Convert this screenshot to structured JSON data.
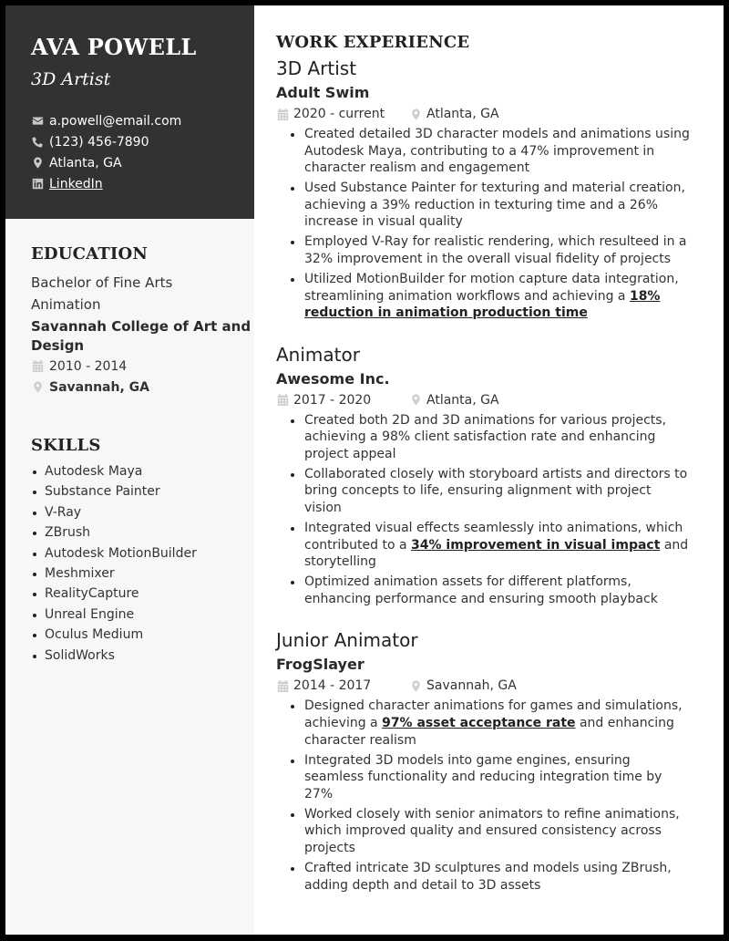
{
  "profile": {
    "name": "AVA POWELL",
    "role": "3D Artist",
    "contacts": {
      "email": "a.powell@email.com",
      "phone": "(123) 456-7890",
      "location": "Atlanta, GA",
      "linkedin": "LinkedIn"
    }
  },
  "education": {
    "title": "EDUCATION",
    "degree": "Bachelor of Fine Arts",
    "field": "Animation",
    "school": "Savannah College of Art and Design",
    "dates": "2010 - 2014",
    "location": "Savannah, GA"
  },
  "skills": {
    "title": "SKILLS",
    "items": [
      "Autodesk Maya",
      "Substance Painter",
      "V-Ray",
      "ZBrush",
      "Autodesk MotionBuilder",
      "Meshmixer",
      "RealityCapture",
      "Unreal Engine",
      "Oculus Medium",
      "SolidWorks"
    ]
  },
  "experience": {
    "title": "WORK EXPERIENCE",
    "jobs": [
      {
        "title": "3D Artist",
        "company": "Adult Swim",
        "dates": "2020 - current",
        "location": "Atlanta, GA",
        "bullets": [
          {
            "pre": "Created detailed 3D character models and animations using Autodesk Maya, contributing to a 47% improvement in character realism and engagement",
            "hl": "",
            "post": ""
          },
          {
            "pre": "Used Substance Painter for texturing and material creation, achieving a 39% reduction in texturing time and a 26% increase in visual quality",
            "hl": "",
            "post": ""
          },
          {
            "pre": "Employed V-Ray for realistic rendering, which resulteed in a 32% improvement in the overall visual fidelity of projects",
            "hl": "",
            "post": ""
          },
          {
            "pre": "Utilized MotionBuilder for motion capture data integration, streamlining animation workflows and achieving a ",
            "hl": "18% reduction in animation production time",
            "post": ""
          }
        ]
      },
      {
        "title": "Animator",
        "company": "Awesome Inc.",
        "dates": "2017 - 2020",
        "location": "Atlanta, GA",
        "bullets": [
          {
            "pre": "Created both 2D and 3D animations for various projects, achieving a 98% client satisfaction rate and enhancing project appeal",
            "hl": "",
            "post": ""
          },
          {
            "pre": "Collaborated closely with storyboard artists and directors to bring concepts to life, ensuring alignment with project vision",
            "hl": "",
            "post": ""
          },
          {
            "pre": "Integrated visual effects seamlessly into animations, which contributed to a ",
            "hl": "34% improvement in visual impact",
            "post": " and storytelling"
          },
          {
            "pre": "Optimized animation assets for different platforms, enhancing performance and ensuring smooth playback",
            "hl": "",
            "post": ""
          }
        ]
      },
      {
        "title": "Junior Animator",
        "company": "FrogSlayer",
        "dates": "2014 - 2017",
        "location": "Savannah, GA",
        "bullets": [
          {
            "pre": "Designed character animations for games and simulations, achieving a ",
            "hl": "97% asset acceptance rate",
            "post": " and enhancing character realism"
          },
          {
            "pre": "Integrated 3D models into game engines, ensuring seamless functionality and reducing integration time by 27%",
            "hl": "",
            "post": ""
          },
          {
            "pre": "Worked closely with senior animators to refine animations, which improved quality and ensured consistency across projects",
            "hl": "",
            "post": ""
          },
          {
            "pre": "Crafted intricate 3D sculptures and models using ZBrush, adding depth and detail to 3D assets",
            "hl": "",
            "post": ""
          }
        ]
      }
    ]
  },
  "icons": {
    "email": "envelope-icon",
    "phone": "phone-icon",
    "location": "map-pin-icon",
    "linkedin": "linkedin-icon",
    "date": "calendar-icon"
  },
  "colors": {
    "sidebar_header_bg": "#323232",
    "sidebar_bg": "#f7f7f7",
    "text": "#333333",
    "icon_gray": "#cfcfcf",
    "frame": "#000000"
  }
}
